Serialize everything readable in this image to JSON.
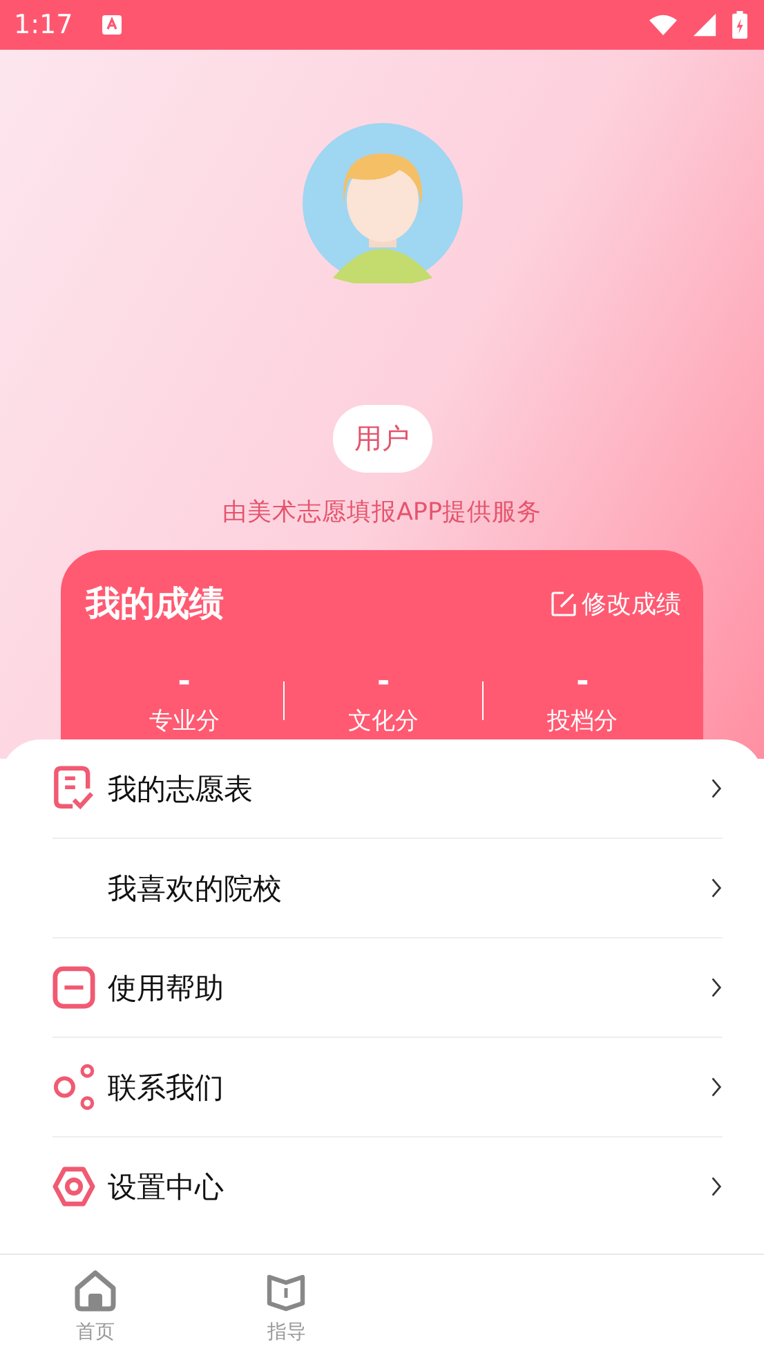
{
  "status_bar": {
    "time": "1:17"
  },
  "profile": {
    "username": "用户",
    "subtitle": "由美术志愿填报APP提供服务"
  },
  "score_card": {
    "title": "我的成绩",
    "edit_label": "修改成绩",
    "scores": [
      {
        "value": "-",
        "label": "专业分"
      },
      {
        "value": "-",
        "label": "文化分"
      },
      {
        "value": "-",
        "label": "投档分"
      }
    ]
  },
  "menu": [
    {
      "kind": "form",
      "label": "我的志愿表"
    },
    {
      "kind": "none",
      "label": "我喜欢的院校"
    },
    {
      "kind": "help",
      "label": "使用帮助"
    },
    {
      "kind": "contact",
      "label": "联系我们"
    },
    {
      "kind": "settings",
      "label": "设置中心"
    }
  ],
  "tab_bar": [
    {
      "kind": "home",
      "label": "首页",
      "selected": false
    },
    {
      "kind": "guide",
      "label": "指导",
      "selected": false
    }
  ]
}
